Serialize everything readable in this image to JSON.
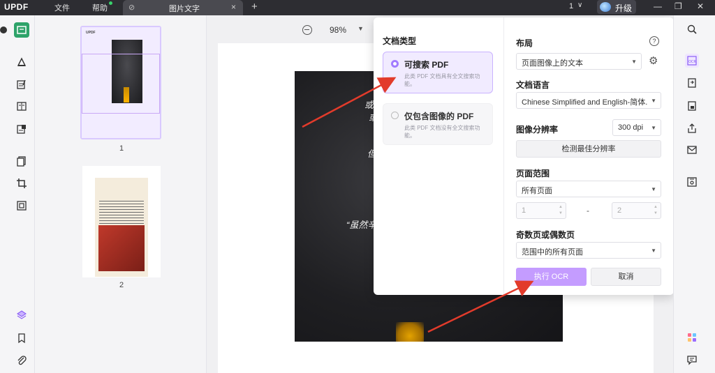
{
  "titlebar": {
    "logo": "UPDF",
    "menu": [
      "文件",
      "帮助"
    ],
    "tab_label": "图片文字",
    "tab_close": "×",
    "new_tab": "+",
    "page_count": "1",
    "upgrade_label": "升级",
    "window_buttons": [
      "—",
      "❐",
      "✕"
    ]
  },
  "thumbnails": [
    {
      "page_number": "1",
      "selected": true,
      "caption_lines": [
        "UPDF"
      ]
    },
    {
      "page_number": "2",
      "selected": false
    }
  ],
  "toolbar": {
    "zoom": "98%"
  },
  "document": {
    "photo_lines": [
      "或许",
      "或许",
      "但我",
      "其",
      "“虽然辛苦"
    ]
  },
  "dialog": {
    "doc_type_label": "文档类型",
    "options": [
      {
        "title": "可搜索 PDF",
        "desc": "此类 PDF 文档具有全文搜索功能。",
        "selected": true
      },
      {
        "title": "仅包含图像的 PDF",
        "desc": "此类 PDF 文档没有全文搜索功能。",
        "selected": false
      }
    ],
    "layout_label": "布局",
    "layout_value": "页面图像上的文本",
    "language_label": "文档语言",
    "language_value": "Chinese Simplified and English-简体...",
    "resolution_label": "图像分辨率",
    "resolution_value": "300 dpi",
    "detect_button": "检测最佳分辨率",
    "page_range_label": "页面范围",
    "page_range_value": "所有页面",
    "range_from": "1",
    "range_dash": "-",
    "range_to": "2",
    "odd_even_label": "奇数页或偶数页",
    "odd_even_value": "范围中的所有页面",
    "run_button": "执行 OCR",
    "cancel_button": "取消"
  },
  "colors": {
    "accent": "#a27cff",
    "primary_button": "#c49cff",
    "annotation_arrow": "#e23b2b",
    "titlebar": "#2d2d32"
  }
}
